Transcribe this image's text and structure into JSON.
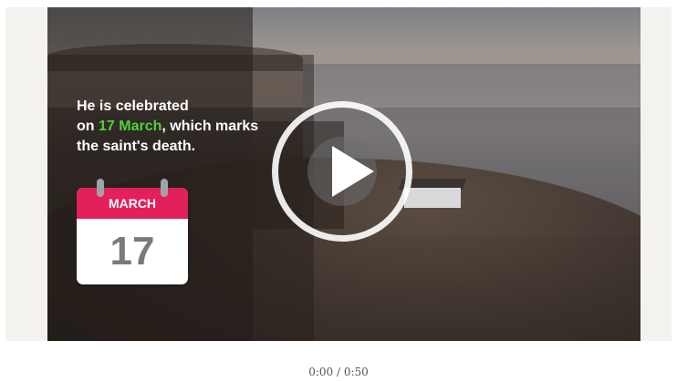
{
  "video": {
    "caption": {
      "line1": "He is celebrated",
      "line2_prefix": "on ",
      "line2_highlight": "17 March",
      "line2_suffix": ", which marks",
      "line3": "the saint's death."
    },
    "calendar": {
      "month": "MARCH",
      "day": "17"
    },
    "play_icon": "play-icon",
    "highlight_color": "#4fd13a",
    "calendar_color": "#e3205a"
  },
  "player": {
    "time": "0:00 / 0:50"
  }
}
